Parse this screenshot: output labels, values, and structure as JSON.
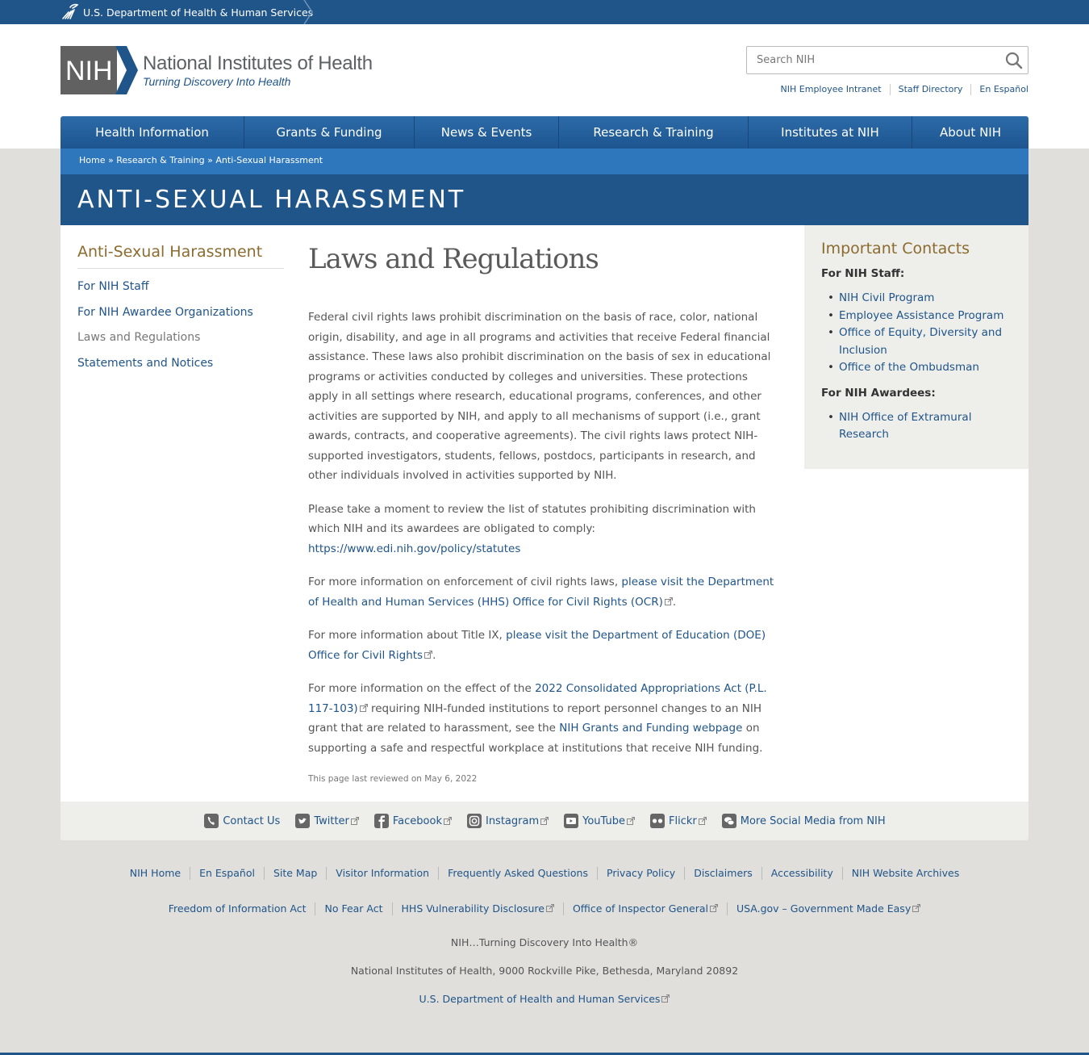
{
  "hhs": {
    "label": "U.S. Department of Health & Human Services"
  },
  "logo": {
    "mark": "NIH",
    "title": "National Institutes of Health",
    "tagline": "Turning Discovery Into Health"
  },
  "search": {
    "placeholder": "Search NIH"
  },
  "utility_links": [
    "NIH Employee Intranet",
    "Staff Directory",
    "En Español"
  ],
  "nav": [
    "Health Information",
    "Grants & Funding",
    "News & Events",
    "Research & Training",
    "Institutes at NIH",
    "About NIH"
  ],
  "breadcrumb": {
    "home": "Home",
    "sep": " » ",
    "research": "Research & Training",
    "current": "Anti-Sexual Harassment"
  },
  "banner_title": "ANTI-SEXUAL HARASSMENT",
  "leftnav": {
    "title": "Anti-Sexual Harassment",
    "items": [
      "For NIH Staff",
      "For NIH Awardee Organizations",
      "Laws and Regulations",
      "Statements and Notices"
    ]
  },
  "main": {
    "title": "Laws and Regulations",
    "p1": "Federal civil rights laws prohibit discrimination on the basis of race, color, national origin, disability, and age in all programs and activities that receive Federal financial assistance. These laws also prohibit discrimination on the basis of sex in educational programs or activities conducted by colleges and universities.  These protections apply in all settings where research, educational programs, conferences, and other activities are supported by NIH, and apply to all mechanisms of support (i.e., grant awards, contracts, and cooperative agreements).  The civil rights laws protect NIH-supported investigators, students, fellows, postdocs, participants in research, and other individuals involved in activities supported by NIH.",
    "p2_text": "Please take a moment to review the list of statutes prohibiting discrimination with which NIH and its awardees are obligated to comply: ",
    "p2_link": "https://www.edi.nih.gov/policy/statutes",
    "p3_text": "For more information on enforcement of civil rights laws, ",
    "p3_link": "please visit the Department of Health and Human Services (HHS) Office for Civil Rights (OCR)",
    "p3_end": ".",
    "p4_text": "For more information about Title IX, ",
    "p4_link": "please visit the Department of Education (DOE) Office for Civil Rights",
    "p4_end": ".",
    "p5_text": "For more information on the effect of the ",
    "p5_link1": "2022 Consolidated Appropriations Act (P.L. 117-103)",
    "p5_mid": " requiring NIH-funded institutions to report personnel changes to an NIH grant that are related to harassment, see the ",
    "p5_link2": "NIH Grants and Funding webpage",
    "p5_end": " on supporting a safe and respectful workplace at institutions that receive NIH funding.",
    "reviewed": "This page last reviewed on May 6, 2022"
  },
  "sidebar": {
    "title": "Important Contacts",
    "staff_heading": "For NIH Staff:",
    "staff_links": [
      "NIH Civil Program",
      "Employee Assistance Program",
      "Office of Equity, Diversity and Inclusion",
      "Office of the Ombudsman"
    ],
    "awardees_heading": "For NIH Awardees:",
    "awardees_links": [
      "NIH Office of Extramural Research"
    ]
  },
  "social": [
    "Contact Us",
    "Twitter",
    "Facebook",
    "Instagram",
    "YouTube",
    "Flickr",
    "More Social Media from NIH"
  ],
  "footer_links_1": [
    "NIH Home",
    "En Español",
    "Site Map",
    "Visitor Information",
    "Frequently Asked Questions",
    "Privacy Policy",
    "Disclaimers",
    "Accessibility",
    "NIH Website Archives"
  ],
  "footer_links_2": [
    "Freedom of Information Act",
    "No Fear Act",
    "HHS Vulnerability Disclosure",
    "Office of Inspector General",
    "USA.gov – Government Made Easy"
  ],
  "footer_tagline": "NIH…Turning Discovery Into Health®",
  "footer_address": "National Institutes of Health, 9000 Rockville Pike, Bethesda, Maryland 20892",
  "footer_hhs": "U.S. Department of Health and Human Services",
  "colors": {
    "primary": "#20558a",
    "accent": "#8b6b2f",
    "breadcrumb": "#2f77bd",
    "page_bg": "#e0dfdb"
  }
}
